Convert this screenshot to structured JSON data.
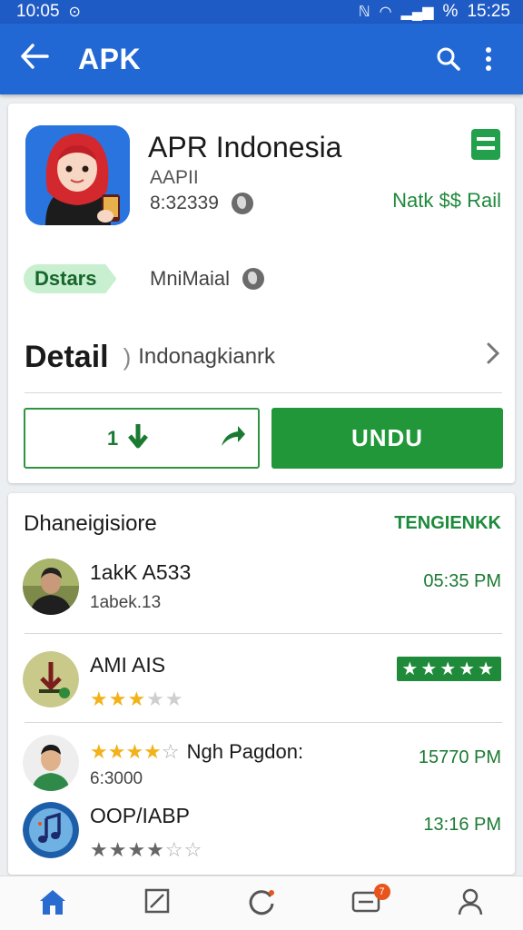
{
  "status_bar": {
    "time_left": "10:05",
    "battery": "%",
    "time_right": "15:25"
  },
  "app_bar": {
    "title": "APK"
  },
  "app": {
    "name": "APR Indonesia",
    "line1": "AAPII",
    "line2": "8:32339",
    "price": "Natk $$ Rail"
  },
  "status": {
    "pill": "Dstars",
    "side": "MniMaial"
  },
  "detail": {
    "title": "Detail",
    "sep": ")",
    "value": "Indonagkianrk"
  },
  "buttons": {
    "outline_label": "1",
    "install_label": "UNDU"
  },
  "list": {
    "heading": "Dhaneigisiore",
    "link": "TENGIENKK",
    "items": [
      {
        "title": "1akK A533",
        "sub": "1abek.13",
        "time": "05:35 PM"
      },
      {
        "title": "AMI AIS",
        "time": ""
      },
      {
        "title": "Ngh Pagdon:",
        "sub": "6:3000",
        "time": "15770 PM"
      },
      {
        "title": "OOP/IABP",
        "time": "13:16 PM"
      }
    ]
  },
  "bottom_nav": {
    "badge": "7"
  },
  "colors": {
    "primary": "#2268d4",
    "accent_green": "#21973a",
    "star": "#f2b21a"
  }
}
